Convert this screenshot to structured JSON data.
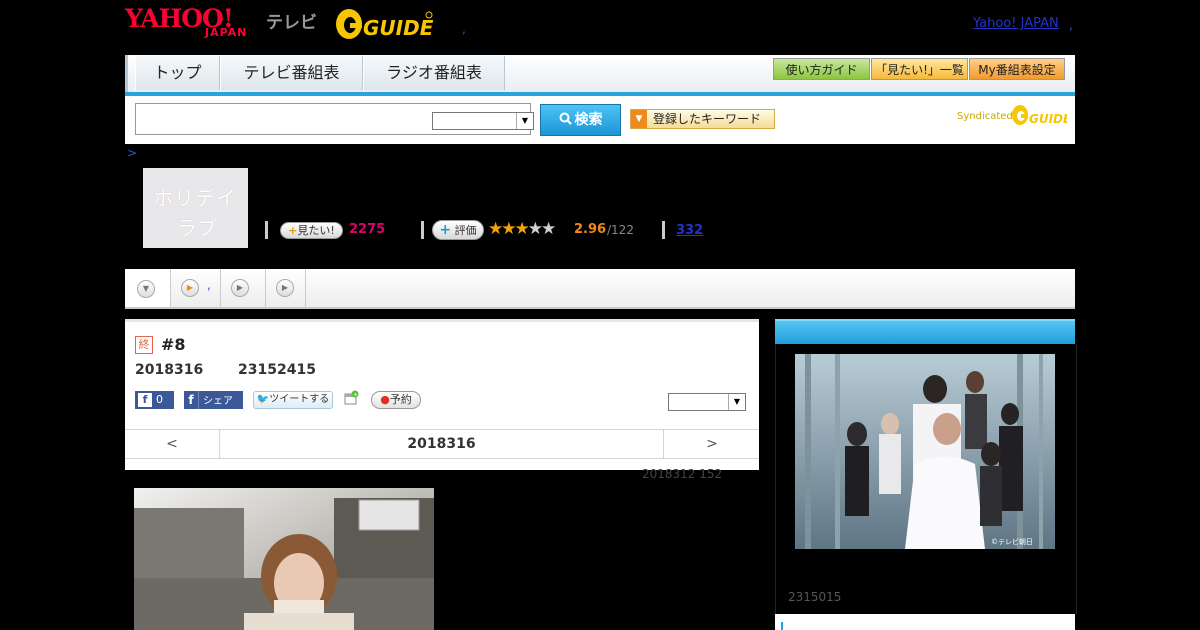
{
  "header": {
    "yahoo_logo": "YAHOO!",
    "yahoo_logo_sub": "JAPAN",
    "tv_label": "テレビ",
    "gguide_logo": "GUIDE",
    "dot": ",",
    "yahoo_japan_link": "Yahoo! JAPAN",
    "dot_right": ","
  },
  "nav": {
    "tabs": [
      "トップ",
      "テレビ番組表",
      "ラジオ番組表"
    ],
    "buttons": [
      "使い方ガイド",
      "「見たい!」一覧",
      "My番組表設定"
    ]
  },
  "search": {
    "input_value": "",
    "select_value": "",
    "button_label": "検索",
    "keyword_button_label": "登録したキーワード",
    "syndicated_label": "Syndicated",
    "syndicated_logo": "GUIDE"
  },
  "breadcrumb": ">",
  "program": {
    "thumb_title_line1": "ホリデイ",
    "thumb_title_line2": "ラブ",
    "mitai_label": "見たい!",
    "mitai_count": "2275",
    "hyouka_label": "評価",
    "rating_value": "2.96",
    "rating_count": "/122",
    "rating_stars": 2.96,
    "review_count": "332"
  },
  "tabstrip": {
    "dot": ","
  },
  "episode": {
    "end_badge": "終",
    "number": "#8",
    "air_date": "2018316",
    "air_time": "23152415",
    "fb_like_count": "0",
    "fb_share_label": "シェア",
    "tweet_label": "ツイートする",
    "yoyaku_label": "予約",
    "select_value": "",
    "prev_label": "<",
    "nav_date": "2018316",
    "next_label": ">",
    "update_note": "2018312  152"
  },
  "right_panel": {
    "header_title": "",
    "copyright": "©テレビ朝日",
    "date": "2315015"
  },
  "colors": {
    "accent_blue": "#29a3e0",
    "yahoo_red": "#ff0033",
    "mitai_pink": "#e0006b",
    "rating_orange": "#f08a1c"
  }
}
